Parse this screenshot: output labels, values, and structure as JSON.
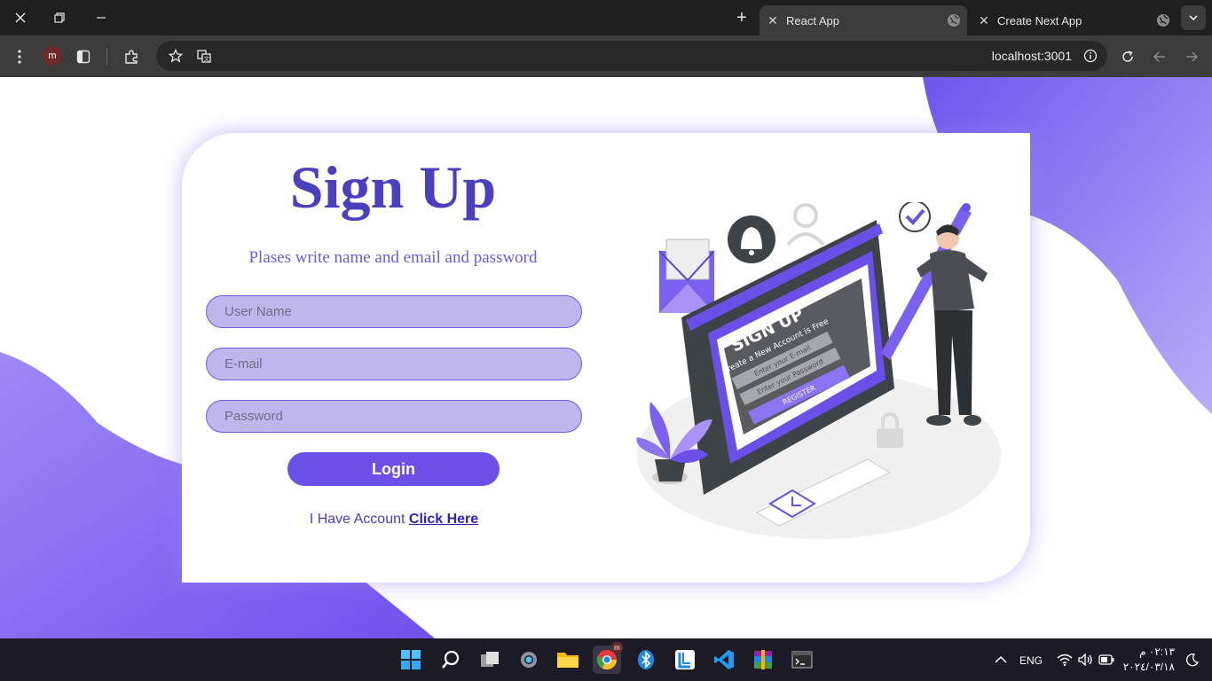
{
  "browser": {
    "tabs": [
      {
        "title": "React App",
        "active": true
      },
      {
        "title": "Create Next App",
        "active": false
      }
    ],
    "profile_initial": "m",
    "url": "localhost:3001"
  },
  "form": {
    "title": "Sign Up",
    "subtitle": "Plases write name and email and password",
    "username_placeholder": "User Name",
    "email_placeholder": "E-mail",
    "password_placeholder": "Password",
    "login_label": "Login",
    "account_text": "I Have Account",
    "account_link": "Click Here"
  },
  "illustration": {
    "heading": "SIGN UP",
    "caption": "Create a New Account is Free",
    "email_field": "Enter your E-mail",
    "password_field": "Enter your Password",
    "register": "REGISTER"
  },
  "taskbar": {
    "language": "ENG",
    "time": "٠٢:١٣ م",
    "date": "٢٠٢٤/٠٣/١٨",
    "chrome_badge": "m",
    "apps": [
      "start-icon",
      "search-icon",
      "task-view-icon",
      "settings-icon",
      "file-explorer-icon",
      "chrome-icon",
      "bluetooth-icon",
      "linear-icon",
      "vscode-icon",
      "winrar-icon",
      "terminal-icon"
    ]
  },
  "colors": {
    "accent": "#6a4fe8",
    "title": "#4a3fbf",
    "field_bg": "#bfb6ee",
    "blob": "#7b61f0"
  }
}
